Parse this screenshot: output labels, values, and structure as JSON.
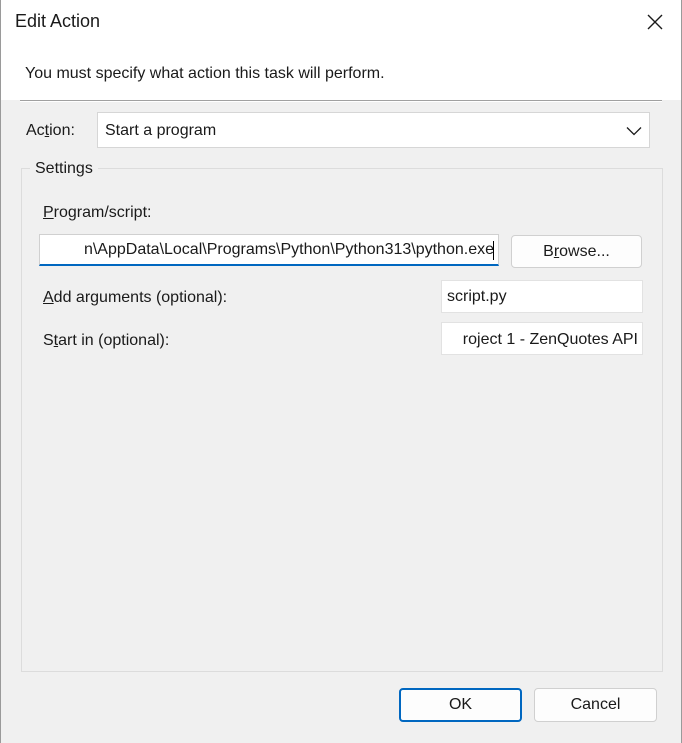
{
  "window": {
    "title": "Edit Action"
  },
  "header": {
    "instruction": "You must specify what action this task will perform."
  },
  "action": {
    "label_prefix": "Ac",
    "label_mnemonic": "t",
    "label_suffix": "ion:",
    "selected": "Start a program"
  },
  "settings": {
    "legend": "Settings",
    "program": {
      "label_mnemonic": "P",
      "label_rest": "rogram/script:",
      "value": "n\\AppData\\Local\\Programs\\Python\\Python313\\python.exe"
    },
    "browse_prefix": "B",
    "browse_mnemonic": "r",
    "browse_suffix": "owse...",
    "arguments": {
      "label_mnemonic": "A",
      "label_rest": "dd arguments (optional):",
      "value": "script.py"
    },
    "start_in": {
      "label_prefix": "S",
      "label_mnemonic": "t",
      "label_rest": "art in (optional):",
      "value": "roject 1 - ZenQuotes  API"
    }
  },
  "footer": {
    "ok_label": "OK",
    "cancel_label": "Cancel"
  },
  "icons": {
    "close": "close-icon",
    "dropdown": "chevron-down-icon"
  },
  "colors": {
    "accent": "#0067c0",
    "background": "#f0f0f0"
  }
}
